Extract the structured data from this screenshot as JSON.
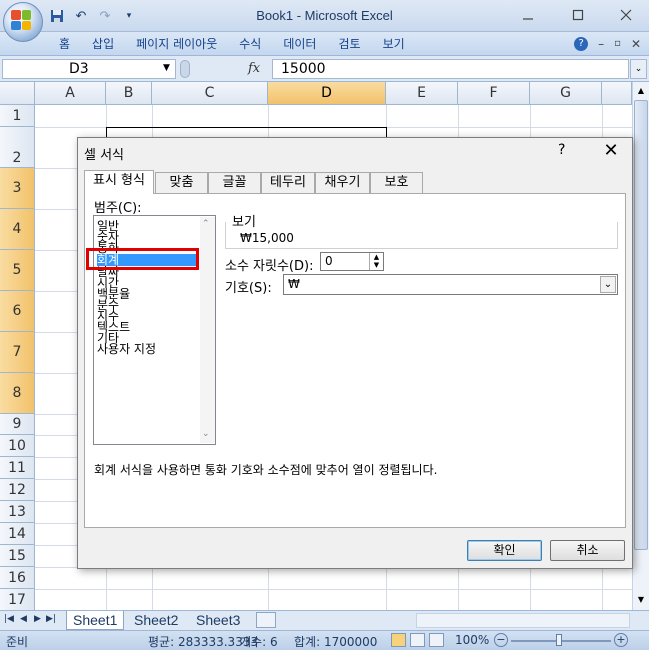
{
  "window": {
    "title": "Book1 - Microsoft Excel"
  },
  "ribbon": {
    "tabs": [
      "홈",
      "삽입",
      "페이지 레이아웃",
      "수식",
      "데이터",
      "검토",
      "보기"
    ]
  },
  "formula_bar": {
    "name_box": "D3",
    "fx": "fx",
    "value": "15000"
  },
  "grid": {
    "columns": [
      "A",
      "B",
      "C",
      "D",
      "E",
      "F",
      "G"
    ],
    "selected_column": "D",
    "rows": [
      "1",
      "2",
      "3",
      "4",
      "5",
      "6",
      "7",
      "8",
      "9",
      "10",
      "11",
      "12",
      "13",
      "14",
      "15",
      "16",
      "17"
    ],
    "selected_rows": [
      "3",
      "4",
      "5",
      "6",
      "7",
      "8"
    ]
  },
  "sheets": {
    "tabs": [
      "Sheet1",
      "Sheet2",
      "Sheet3"
    ],
    "active": "Sheet1"
  },
  "status": {
    "mode": "준비",
    "average": "평균: 283333.3333",
    "count": "개수: 6",
    "sum": "합계: 1700000",
    "zoom": "100%"
  },
  "dialog": {
    "title": "셀 서식",
    "help": "?",
    "tabs": [
      "표시 형식",
      "맞춤",
      "글꼴",
      "테두리",
      "채우기",
      "보호"
    ],
    "active_tab": "표시 형식",
    "category_label": "범주(C):",
    "categories": [
      "일반",
      "숫자",
      "통화",
      "회계",
      "날짜",
      "시간",
      "백분율",
      "분수",
      "지수",
      "텍스트",
      "기타",
      "사용자 지정"
    ],
    "selected_category": "회계",
    "sample_label": "보기",
    "sample_value": "₩15,000",
    "decimal_label": "소수 자릿수(D):",
    "decimal_value": "0",
    "symbol_label": "기호(S):",
    "symbol_value": "₩",
    "description": "회계 서식을 사용하면 통화 기호와 소수점에 맞추어 열이 정렬됩니다.",
    "ok": "확인",
    "cancel": "취소"
  },
  "colors": {
    "accent": "#3399ff",
    "highlight": "#e00000",
    "header_selected": "#f2c26b"
  }
}
